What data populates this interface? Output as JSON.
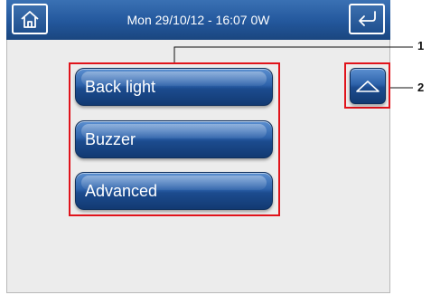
{
  "header": {
    "status_text": "Mon 29/10/12 - 16:07   0W",
    "home_icon": "home-icon",
    "back_icon": "return-arrow-icon"
  },
  "menu": {
    "items": [
      {
        "label": "Back light"
      },
      {
        "label": "Buzzer"
      },
      {
        "label": "Advanced"
      }
    ]
  },
  "scroll": {
    "up_icon": "triangle-up-icon"
  },
  "callouts": {
    "one": "1",
    "two": "2"
  },
  "colors": {
    "accent_blue": "#23579c",
    "highlight_red": "#e0131b",
    "background": "#ececec"
  }
}
